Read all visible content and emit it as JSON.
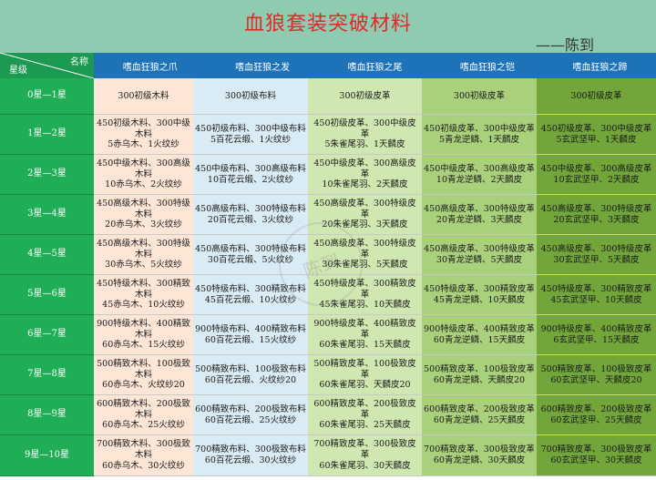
{
  "title": "血狼套装突破材料",
  "author": "——陈到",
  "corner": {
    "name_label": "名称",
    "star_label": "星级"
  },
  "columns": [
    "嗜血狂狼之爪",
    "嗜血狂狼之发",
    "嗜血狂狼之尾",
    "嗜血狂狼之铠",
    "嗜血狂狼之蹄"
  ],
  "rows": [
    {
      "label": "0星—1星",
      "cells": [
        "300初级木料",
        "300初级布料",
        "300初级皮革",
        "300初级皮革",
        "300初级皮革"
      ]
    },
    {
      "label": "1星—2星",
      "cells": [
        "450初级木料、300中级木料\n5赤乌木、1火纹纱",
        "450初级布料、300中级布料\n5百花云缎、1火纹纱",
        "450初级皮革、300中级皮革\n5朱雀尾羽、1天麟皮",
        "450初级皮革、300中级皮革\n5青龙逆鳞、1天麟皮",
        "450初级皮革、300中级皮革\n5玄武坚甲、1天麟皮"
      ]
    },
    {
      "label": "2星—3星",
      "cells": [
        "450中级木料、300高级木料\n10赤乌木、2火纹纱",
        "450中级布料、300高级布料\n10百花云缎、2火纹纱",
        "450中级皮革、300高级皮革\n10朱雀尾羽、2天麟皮",
        "450中级皮革、300高级皮革\n10青龙逆鳞、2天麟皮",
        "450中级皮革、300高级皮革\n10玄武坚甲、2天麟皮"
      ]
    },
    {
      "label": "3星—4星",
      "cells": [
        "450高级木料、300特级木料\n20赤乌木、3火纹纱",
        "450高级布料、300特级布料\n20百花云缎、3火纹纱",
        "450高级皮革、300特级皮革\n20朱雀尾羽、3天麟皮",
        "450高级皮革、300特级皮革\n20青龙逆鳞、3天麟皮",
        "450高级皮革、300特级皮革\n20玄武坚甲、3天麟皮"
      ]
    },
    {
      "label": "4星—5星",
      "cells": [
        "450高级木料、300特级木料\n30赤乌木、5火纹纱",
        "450高级布料、300特级布料\n30百花云缎、5火纹纱",
        "450高级皮革、300特级皮革\n30朱雀尾羽、5天麟皮",
        "450高级皮革、300特级皮革\n30青龙逆鳞、5天麟皮",
        "450高级皮革、300特级皮革\n30玄武坚甲、5天麟皮"
      ]
    },
    {
      "label": "5星—6星",
      "cells": [
        "450特级木料、300精致木料\n45赤乌木、10火纹纱",
        "450特级布料、300精致布料\n45百花云缎、10火纹纱",
        "450特级皮革、300精致皮革\n45朱雀尾羽、10天麟皮",
        "450特级皮革、300精致皮革\n45青龙逆鳞、10天麟皮",
        "450特级皮革、300精致皮革\n45玄武坚甲、10天麟皮"
      ]
    },
    {
      "label": "6星—7星",
      "cells": [
        "900特级木料、400精致木料\n60赤乌木、15火纹纱",
        "900特级布料、400精致布料\n60百花云缎、15火纹纱",
        "900特级皮革、400精致皮革\n60朱雀尾羽、15天麟皮",
        "900特级皮革、400精致皮革\n60青龙逆鳞、15天麟皮",
        "900特级皮革、400精致皮革\n6玄武坚甲、15天麟皮"
      ]
    },
    {
      "label": "7星—8星",
      "cells": [
        "500精致木料、100极致木料\n60赤乌木、火纹纱20",
        "500精致布料、100极致布料\n60百花云缎、火纹纱20",
        "500精致皮革、100极致皮革\n60朱雀尾羽、天麟皮20",
        "500精致皮革、100极致皮革\n60青龙逆鳞、天麟皮20",
        "500精致皮革、100极致皮革\n60玄武坚甲、天麟皮20"
      ]
    },
    {
      "label": "8星—9星",
      "cells": [
        "600精致木料、200极致木料\n60赤乌木、25火纹纱",
        "600精致布料、200极致布料\n60百花云缎、25火纹纱",
        "600精致皮革、200极致皮革\n60朱雀尾羽、25天麟皮",
        "600精致皮革、200极致皮革\n60青龙逆鳞、25天麟皮",
        "600精致皮革、200极致皮革\n60玄武坚甲、25天麟皮"
      ]
    },
    {
      "label": "9星—10星",
      "cells": [
        "700精致木料、300极致木料\n60赤乌木、30火纹纱",
        "700精致布料、300极致布料\n60百花云缎、30火纹纱",
        "700精致皮革、300极致皮革\n60朱雀尾羽、30天麟皮",
        "700精致皮革、300极致皮革\n60青龙逆鳞、30天麟皮",
        "700精致皮革、300极致皮革\n60玄武坚甲、30天麟皮"
      ]
    }
  ],
  "watermark": "陈到",
  "colors": {
    "header": "#8ecbb0",
    "title": "#e02a2a",
    "colhead": "#1e72b8",
    "rowlabel": "#1fae55"
  }
}
